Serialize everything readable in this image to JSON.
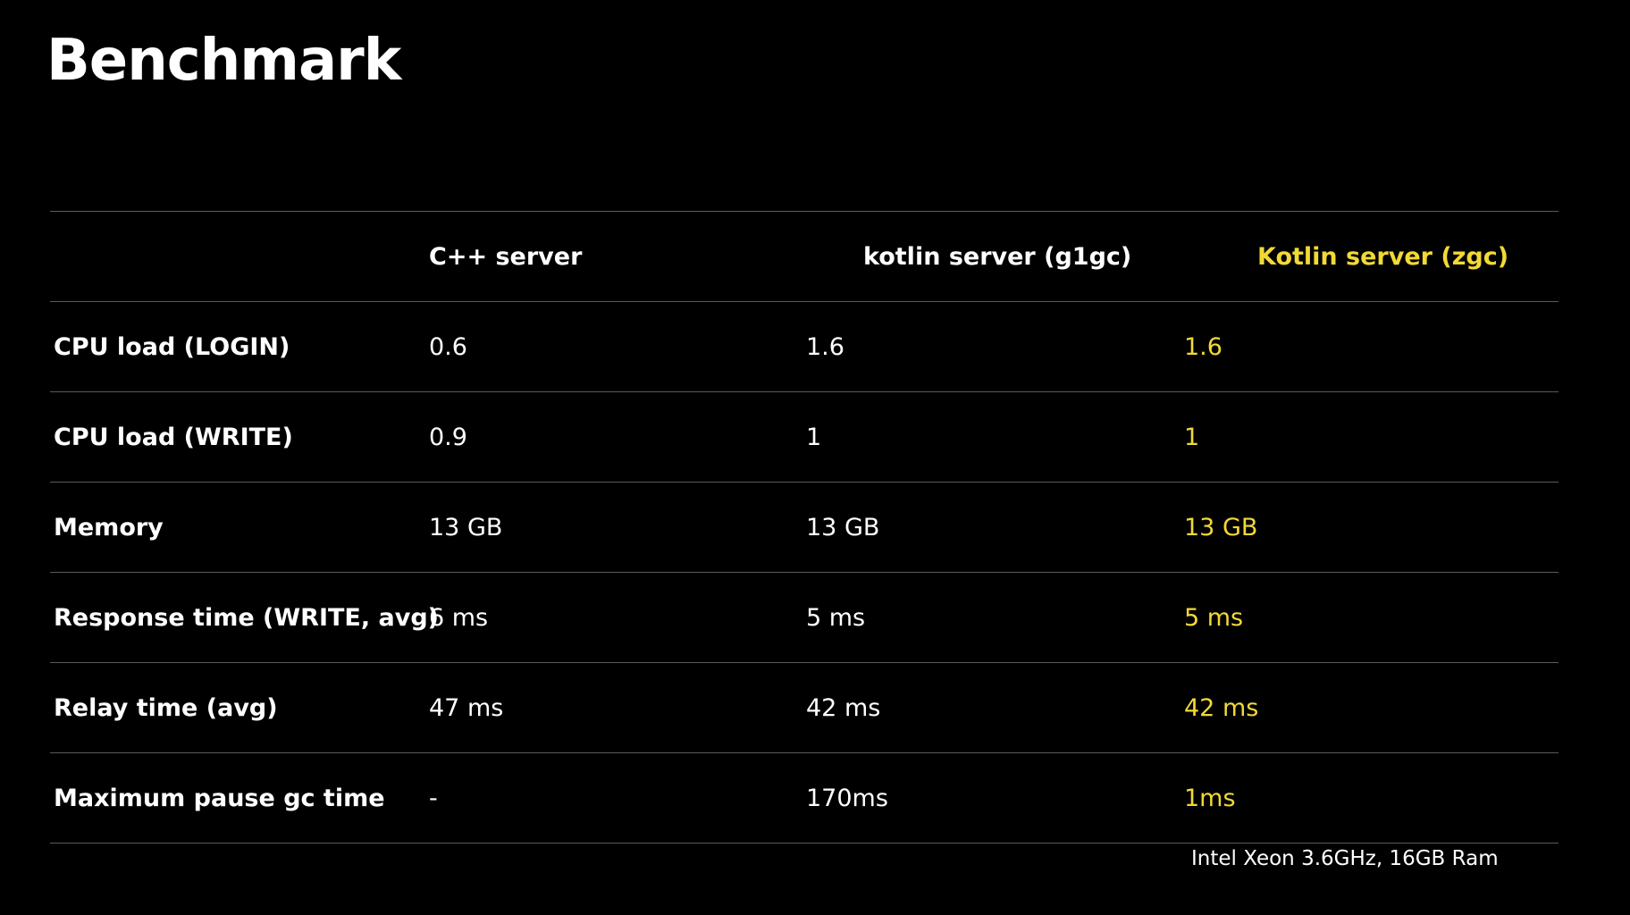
{
  "title": "Benchmark",
  "colors": {
    "background": "#000000",
    "text": "#ffffff",
    "highlight": "#f2d936",
    "rule": "#5a5a5a"
  },
  "table": {
    "headers": [
      "",
      "C++ server",
      "kotlin server (g1gc)",
      "Kotlin server (zgc)"
    ],
    "rows": [
      {
        "metric": "CPU load (LOGIN)",
        "cpp": "0.6",
        "kotlin_g1gc": "1.6",
        "kotlin_zgc": "1.6"
      },
      {
        "metric": "CPU load (WRITE)",
        "cpp": "0.9",
        "kotlin_g1gc": "1",
        "kotlin_zgc": "1"
      },
      {
        "metric": "Memory",
        "cpp": "13 GB",
        "kotlin_g1gc": "13 GB",
        "kotlin_zgc": "13 GB"
      },
      {
        "metric": "Response time (WRITE, avg)",
        "cpp": "6 ms",
        "kotlin_g1gc": "5 ms",
        "kotlin_zgc": "5 ms"
      },
      {
        "metric": "Relay time (avg)",
        "cpp": "47 ms",
        "kotlin_g1gc": "42 ms",
        "kotlin_zgc": "42 ms"
      },
      {
        "metric": "Maximum pause gc time",
        "cpp": "-",
        "kotlin_g1gc": "170ms",
        "kotlin_zgc": "1ms"
      }
    ]
  },
  "footnote": "Intel Xeon  3.6GHz, 16GB Ram"
}
